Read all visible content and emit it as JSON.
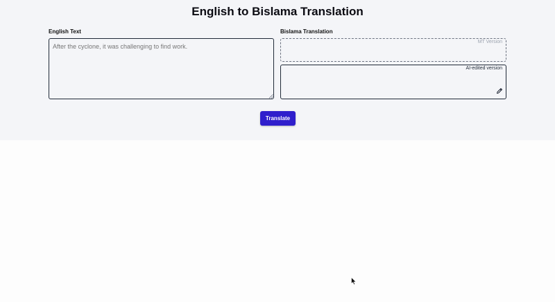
{
  "header": {
    "title": "English to Bislama Translation"
  },
  "english": {
    "label": "English Text",
    "placeholder": "After the cyclone, it was challenging to find work.",
    "value": ""
  },
  "bislama": {
    "label": "Bislama Translation",
    "mt_caption": "MT Version",
    "ai_caption": "AI-edited version"
  },
  "actions": {
    "translate_label": "Translate"
  },
  "icons": {
    "edit": "pencil-icon",
    "resize": "resize-grip-icon",
    "pointer": "mouse-cursor-icon"
  },
  "colors": {
    "accent": "#2f1fcc",
    "panel_background": "#f4f5f8"
  }
}
